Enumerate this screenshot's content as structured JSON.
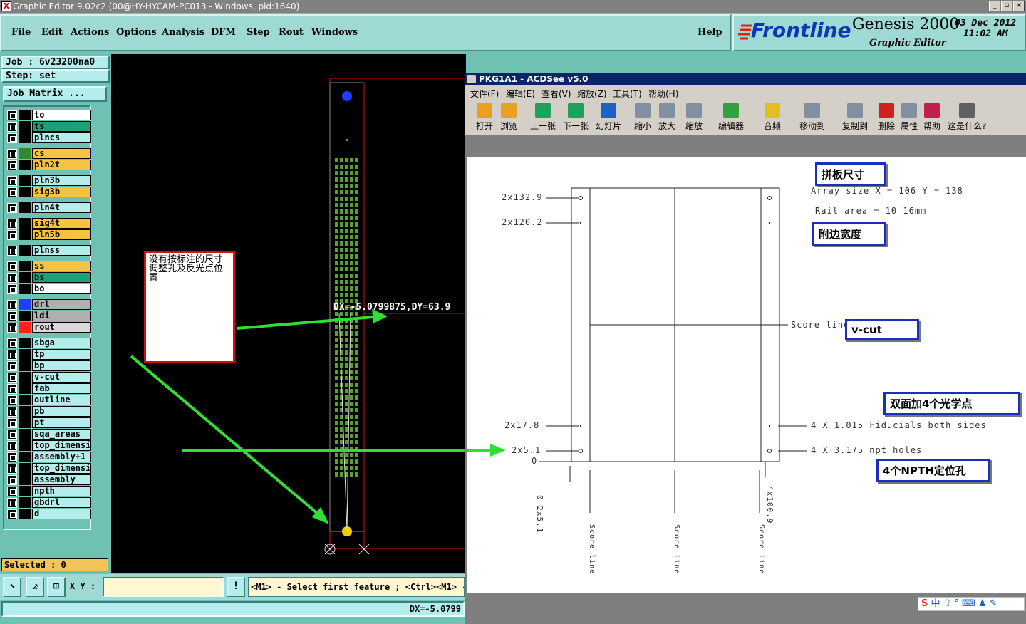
{
  "window": {
    "title": "Graphic Editor 9.02c2 (00@HY-HYCAM-PC013 - Windows, pid:1640)"
  },
  "menu": [
    "File",
    "Edit",
    "Actions",
    "Options",
    "Analysis",
    "DFM",
    "Step",
    "Rout",
    "Windows"
  ],
  "help": "Help",
  "brand": {
    "logo": "Frontline",
    "product": "Genesis 2000",
    "subtitle": "Graphic Editor",
    "date": "03 Dec 2012",
    "time": "11:02 AM"
  },
  "job": {
    "job_label": "Job : 6v23200na0",
    "step_label": "Step: set",
    "matrix_button": "Job Matrix ..."
  },
  "layers": [
    {
      "name": "to",
      "color": "#ffffff",
      "swatch": "#000000"
    },
    {
      "name": "ts",
      "color": "#1f9e7a",
      "swatch": "#000000"
    },
    {
      "name": "plncs",
      "color": "#b5ecec",
      "swatch": "#000000"
    },
    {
      "name": "cs",
      "color": "#f5c242",
      "swatch": "#2e8b2e"
    },
    {
      "name": "pln2t",
      "color": "#f5c242",
      "swatch": "#000000"
    },
    {
      "name": "pln3b",
      "color": "#b5ecec",
      "swatch": "#000000"
    },
    {
      "name": "sig3b",
      "color": "#f5c242",
      "swatch": "#000000"
    },
    {
      "name": "pln4t",
      "color": "#b5ecec",
      "swatch": "#000000"
    },
    {
      "name": "sig4t",
      "color": "#f5c242",
      "swatch": "#000000"
    },
    {
      "name": "pln5b",
      "color": "#f5c242",
      "swatch": "#000000"
    },
    {
      "name": "plnss",
      "color": "#b5ecec",
      "swatch": "#000000"
    },
    {
      "name": "ss",
      "color": "#f5c242",
      "swatch": "#000000"
    },
    {
      "name": "bs",
      "color": "#1f9e7a",
      "swatch": "#000000"
    },
    {
      "name": "bo",
      "color": "#ffffff",
      "swatch": "#000000"
    },
    {
      "name": "drl",
      "color": "#b0b0b0",
      "swatch": "#1f3fff"
    },
    {
      "name": "ldi",
      "color": "#b0b0b0",
      "swatch": "#000000"
    },
    {
      "name": "rout",
      "color": "#d8d8d8",
      "swatch": "#ff2020"
    },
    {
      "name": "sbga",
      "color": "#b5ecec",
      "swatch": "#000000"
    },
    {
      "name": "tp",
      "color": "#b5ecec",
      "swatch": "#000000"
    },
    {
      "name": "bp",
      "color": "#b5ecec",
      "swatch": "#000000"
    },
    {
      "name": "v-cut",
      "color": "#b5ecec",
      "swatch": "#000000"
    },
    {
      "name": "fab",
      "color": "#b5ecec",
      "swatch": "#000000"
    },
    {
      "name": "outline",
      "color": "#b5ecec",
      "swatch": "#000000"
    },
    {
      "name": "pb",
      "color": "#b5ecec",
      "swatch": "#000000"
    },
    {
      "name": "pt",
      "color": "#b5ecec",
      "swatch": "#000000"
    },
    {
      "name": "sqa_areas",
      "color": "#b5ecec",
      "swatch": "#000000"
    },
    {
      "name": "top_dimensio",
      "color": "#b5ecec",
      "swatch": "#000000"
    },
    {
      "name": "assembly+1",
      "color": "#b5ecec",
      "swatch": "#000000"
    },
    {
      "name": "top_dimensio",
      "color": "#b5ecec",
      "swatch": "#000000"
    },
    {
      "name": "assembly",
      "color": "#b5ecec",
      "swatch": "#000000"
    },
    {
      "name": "npth",
      "color": "#b5ecec",
      "swatch": "#000000"
    },
    {
      "name": "gbdrl",
      "color": "#b5ecec",
      "swatch": "#000000"
    },
    {
      "name": "d",
      "color": "#b5ecec",
      "swatch": "#000000"
    }
  ],
  "canvas": {
    "measure": "DX=-5.0799875,DY=63.9",
    "annotation": "没有按标注的尺寸调整孔及反光点位置"
  },
  "selected": "Selected : 0",
  "coords_label": "X Y :",
  "coords_value": "",
  "prompt": "<M1> - Select first feature ; <Ctrl><M1> -",
  "status_dx": "DX=-5.0799",
  "acdsee": {
    "title": "PKG1A1 - ACDSee v5.0",
    "menu": [
      "文件(F)",
      "编辑(E)",
      "查看(V)",
      "缩放(Z)",
      "工具(T)",
      "帮助(H)"
    ],
    "tools": [
      {
        "label": "打开",
        "icon": "folder-open-icon"
      },
      {
        "label": "浏览",
        "icon": "browse-icon"
      },
      {
        "label": "上一张",
        "icon": "previous-icon"
      },
      {
        "label": "下一张",
        "icon": "next-icon"
      },
      {
        "label": "幻灯片",
        "icon": "slideshow-icon"
      },
      {
        "label": "缩小",
        "icon": "zoom-out-icon"
      },
      {
        "label": "放大",
        "icon": "zoom-in-icon"
      },
      {
        "label": "缩放",
        "icon": "zoom-icon"
      },
      {
        "label": "编辑器",
        "icon": "editor-icon"
      },
      {
        "label": "音频",
        "icon": "audio-icon"
      },
      {
        "label": "移动到",
        "icon": "move-icon"
      },
      {
        "label": "复制到",
        "icon": "copy-icon"
      },
      {
        "label": "删除",
        "icon": "delete-icon"
      },
      {
        "label": "属性",
        "icon": "properties-icon"
      },
      {
        "label": "帮助",
        "icon": "help-book-icon"
      },
      {
        "label": "这是什么?",
        "icon": "whats-this-icon"
      }
    ],
    "drawing": {
      "array_size": "Array size  X = 106 Y = 138",
      "rail_area": "Rail area = 10 16mm",
      "dims_left": [
        "2x132.9",
        "2x120.2",
        "2x17.8",
        "2x5.1",
        "0"
      ],
      "fiducials": "4 X 1.015 Fiducials both sides",
      "npth_holes": "4 X 3.175 npt holes",
      "score_line": "Score line",
      "score_line_v": "Score line",
      "dim_bottom_left": "0 2x5.1",
      "dim_bottom_right": "4x100.9",
      "notes": {
        "panel_size": "拼板尺寸",
        "rail_width": "附边宽度",
        "vcut": "v-cut",
        "fiducial_note": "双面加4个光学点",
        "npth_note": "4个NPTH定位孔"
      }
    }
  }
}
